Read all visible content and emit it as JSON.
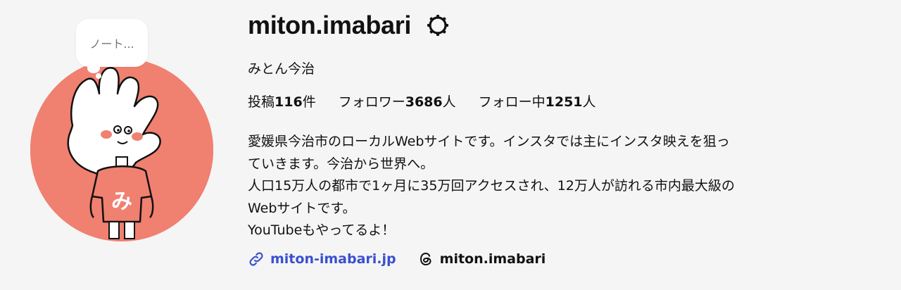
{
  "profile": {
    "username": "miton.imabari",
    "display_name": "みとん今治",
    "note_placeholder": "ノート...",
    "stats": {
      "posts_label": "投稿",
      "posts_count": "116",
      "posts_unit": "件",
      "followers_label": "フォロワー",
      "followers_count": "3686",
      "followers_unit": "人",
      "following_label": "フォロー中",
      "following_count": "1251",
      "following_unit": "人"
    },
    "bio_lines": [
      "愛媛県今治市のローカルWebサイトです。インスタでは主にインスタ映えを狙っ",
      "ていきます。今治から世界へ。",
      "人口15万人の都市で1ヶ月に35万回アクセスされ、12万人が訪れる市内最大級の",
      "Webサイトです。",
      "YouTubeもやってるよ！"
    ],
    "website": "miton-imabari.jp",
    "threads_handle": "miton.imabari",
    "avatar_letter": "み"
  },
  "icons": {
    "settings": "gear-icon",
    "link": "link-icon",
    "threads": "threads-icon"
  },
  "colors": {
    "avatar_bg": "#f08070",
    "link": "#3a50d0",
    "text": "#111111"
  }
}
